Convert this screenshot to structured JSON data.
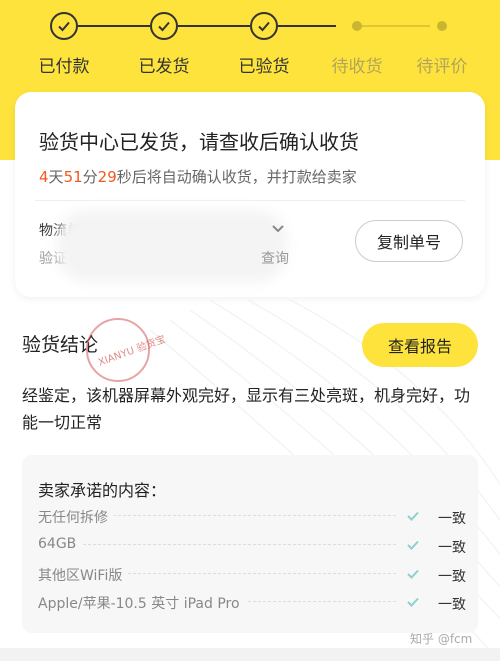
{
  "steps": [
    {
      "label": "已付款",
      "state": "done"
    },
    {
      "label": "已发货",
      "state": "done"
    },
    {
      "label": "已验货",
      "state": "done"
    },
    {
      "label": "待收货",
      "state": "pending"
    },
    {
      "label": "待评价",
      "state": "pending"
    }
  ],
  "card": {
    "title": "验货中心已发货，请查收后确认收货",
    "countdown": {
      "days": "4",
      "days_unit": "天",
      "minutes": "51",
      "minutes_unit": "分",
      "seconds": "29",
      "suffix": "秒后将自动确认收货，并打款给卖家"
    },
    "logistics_label": "物流单号",
    "logistics_sub": "验证",
    "query_link": "查询",
    "copy_button": "复制单号"
  },
  "result": {
    "title": "验货结论",
    "report_button": "查看报告",
    "text": "经鉴定，该机器屏幕外观完好，显示有三处亮斑，机身完好，功能一切正常",
    "stamp_text": "XIANYU 验货宝"
  },
  "promise": {
    "title": "卖家承诺的内容：",
    "items": [
      {
        "label": "无任何拆修",
        "value": "一致"
      },
      {
        "label": "64GB",
        "value": "一致"
      },
      {
        "label": "其他区WiFi版",
        "value": "一致"
      },
      {
        "label": "Apple/苹果-10.5 英寸 iPad Pro",
        "value": "一致"
      }
    ]
  },
  "watermark": "知乎 @fcm",
  "colors": {
    "brand_yellow": "#fde33b",
    "countdown_orange": "#f4581e",
    "check_teal": "#8fcfcf"
  }
}
